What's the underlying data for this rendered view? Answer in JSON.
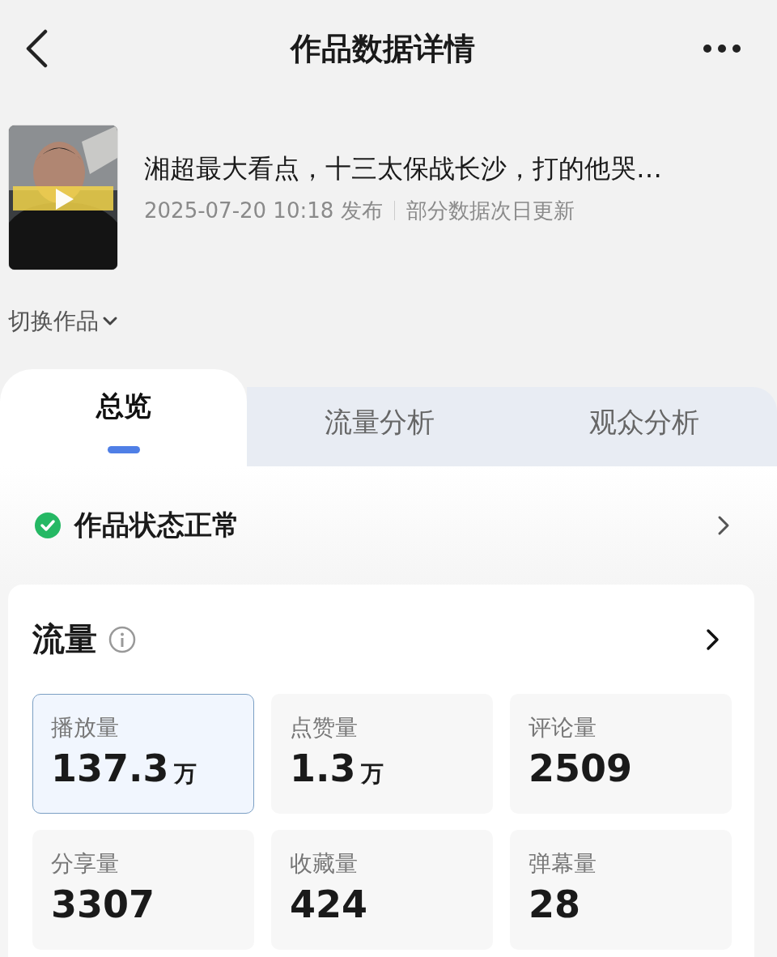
{
  "header": {
    "title": "作品数据详情"
  },
  "video": {
    "title": "湘超最大看点，十三太保战长沙，打的他哭…",
    "published": "2025-07-20 10:18 发布",
    "note": "部分数据次日更新"
  },
  "switch_label": "切换作品",
  "tabs": [
    {
      "label": "总览",
      "selected": true
    },
    {
      "label": "流量分析",
      "selected": false
    },
    {
      "label": "观众分析",
      "selected": false
    }
  ],
  "status": {
    "label": "作品状态正常"
  },
  "traffic": {
    "title": "流量",
    "metrics": [
      {
        "label": "播放量",
        "value": "137.3",
        "unit": "万",
        "selected": true
      },
      {
        "label": "点赞量",
        "value": "1.3",
        "unit": "万",
        "selected": false
      },
      {
        "label": "评论量",
        "value": "2509",
        "selected": false
      },
      {
        "label": "分享量",
        "value": "3307",
        "selected": false
      },
      {
        "label": "收藏量",
        "value": "424",
        "selected": false
      },
      {
        "label": "弹幕量",
        "value": "28",
        "selected": false
      }
    ]
  }
}
